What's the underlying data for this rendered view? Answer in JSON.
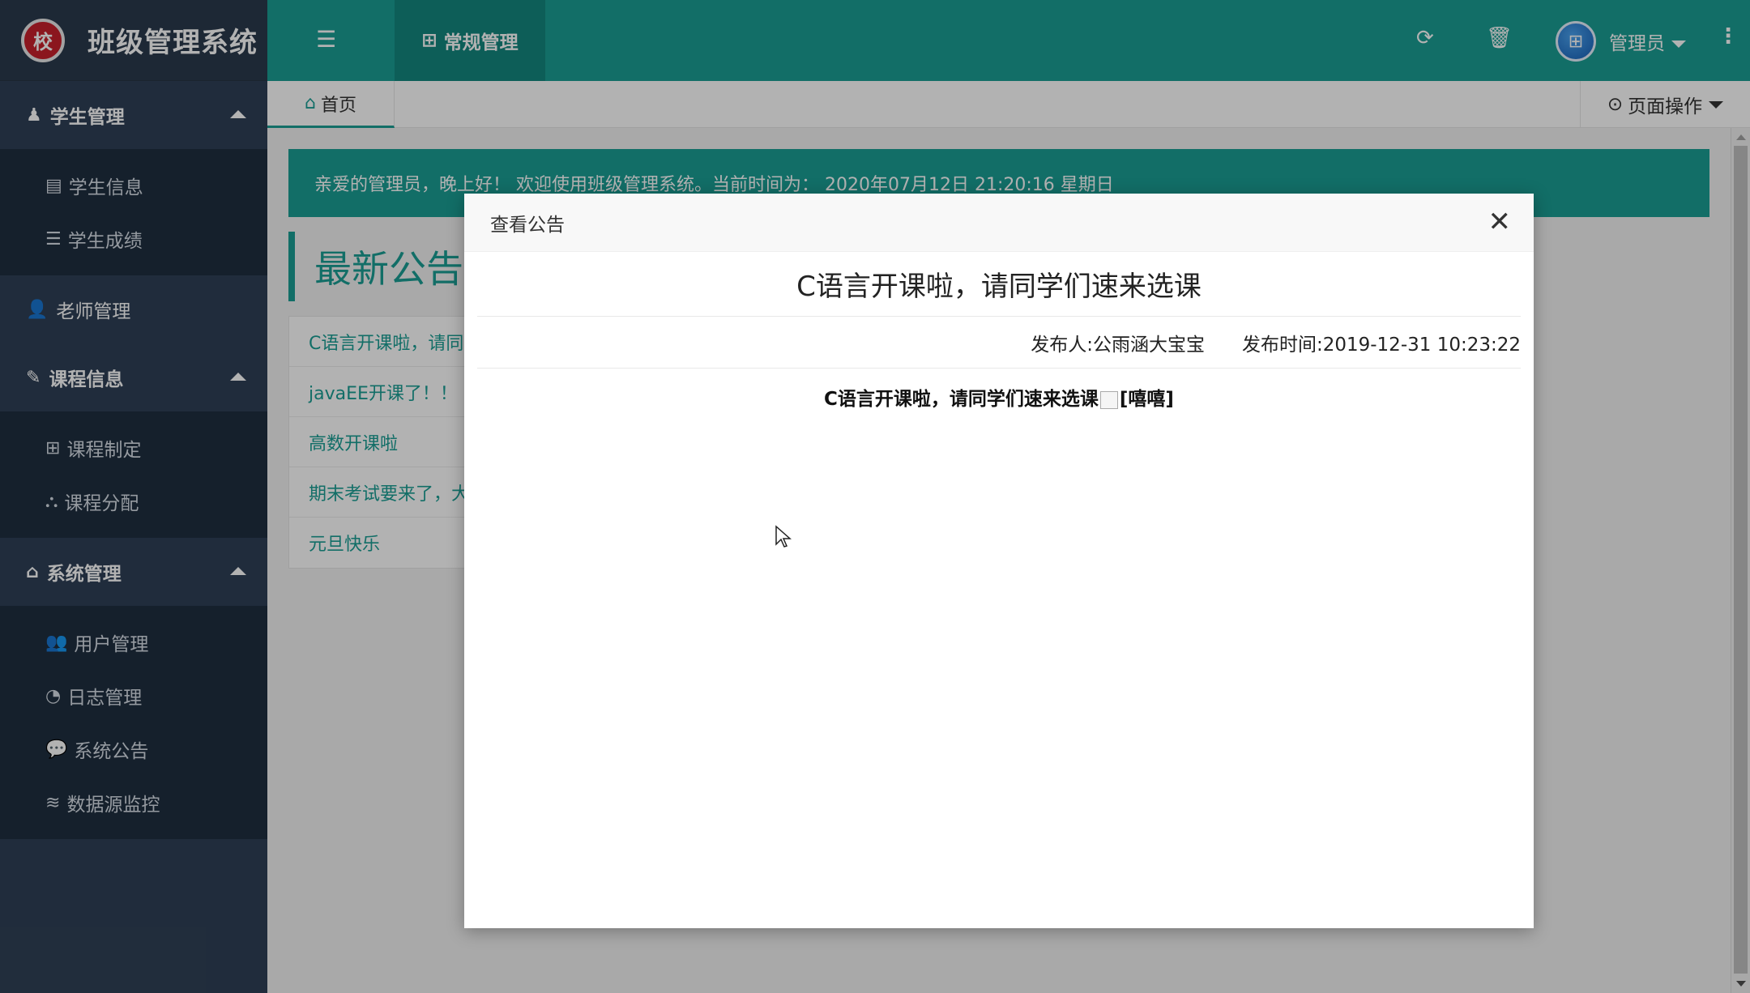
{
  "app": {
    "title": "班级管理系统",
    "logo_glyph": "校"
  },
  "sidebar": {
    "groups": [
      {
        "label": "学生管理",
        "icon": "student-icon",
        "expanded": true,
        "items": [
          {
            "label": "学生信息",
            "icon": "list-icon"
          },
          {
            "label": "学生成绩",
            "icon": "bars-icon"
          }
        ]
      },
      {
        "label": "老师管理",
        "icon": "user-icon",
        "expanded": false,
        "items": []
      },
      {
        "label": "课程信息",
        "icon": "edit-icon",
        "expanded": true,
        "items": [
          {
            "label": "课程制定",
            "icon": "plus-square-icon"
          },
          {
            "label": "课程分配",
            "icon": "sitemap-icon"
          }
        ]
      },
      {
        "label": "系统管理",
        "icon": "home-icon",
        "expanded": true,
        "items": [
          {
            "label": "用户管理",
            "icon": "users-icon"
          },
          {
            "label": "日志管理",
            "icon": "pie-chart-icon"
          },
          {
            "label": "系统公告",
            "icon": "comment-icon"
          },
          {
            "label": "数据源监控",
            "icon": "database-icon"
          }
        ]
      }
    ]
  },
  "topbar": {
    "active_tab": "常规管理",
    "user_name": "管理员"
  },
  "tabstrip": {
    "home_label": "首页",
    "page_ops_label": "页面操作"
  },
  "main": {
    "welcome": "亲爱的管理员，晚上好！ 欢迎使用班级管理系统。当前时间为： 2020年07月12日 21:20:16   星期日",
    "notice_heading": "最新公告",
    "notices": [
      "C语言开课啦，请同学们速来选课",
      "javaEE开课了！！",
      "高数开课啦",
      "期末考试要来了，大家加油复习",
      "元旦快乐"
    ]
  },
  "modal": {
    "header": "查看公告",
    "title": "C语言开课啦，请同学们速来选课",
    "publisher": "发布人:公雨涵大宝宝",
    "publish_time": "发布时间:2019-12-31 10:23:22",
    "content_text": "C语言开课啦，请同学们速来选课",
    "emoji_alt": "[嘻嘻]"
  },
  "colors": {
    "accent": "#1a9e94",
    "sidebar_bg": "#2f4056",
    "sidebar_sub_bg": "#1f2e3f"
  }
}
